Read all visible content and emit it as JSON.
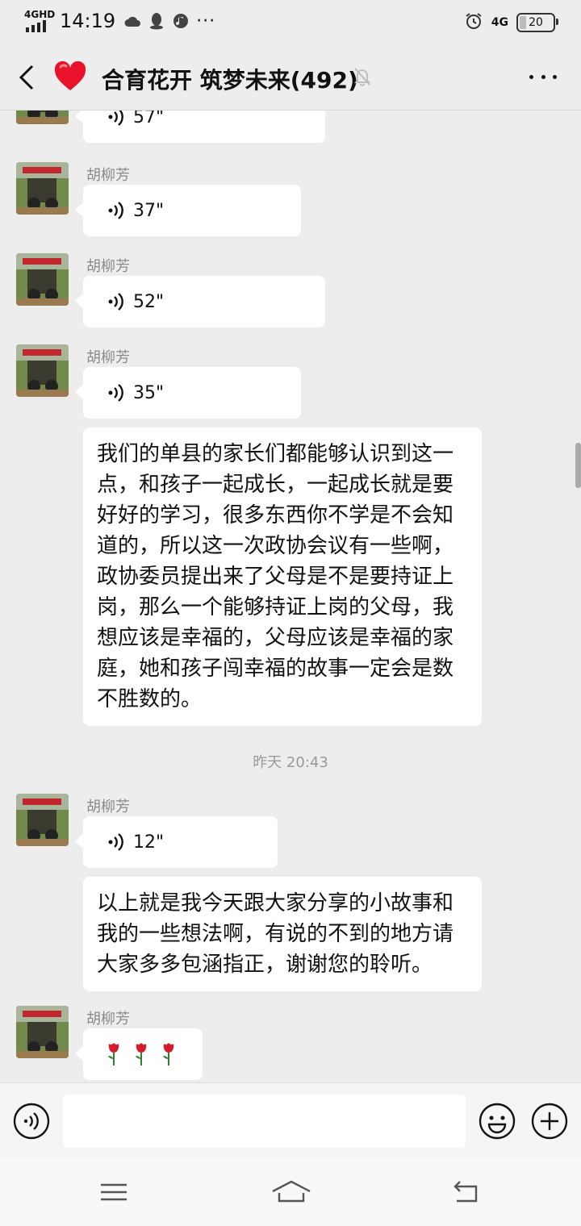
{
  "status_bar": {
    "network": "4GHD",
    "time": "14:19",
    "dots": "···",
    "network_right": "4G",
    "battery": "20"
  },
  "header": {
    "title": "合育花开 筑梦未来(492)",
    "avatar_icon": "heart-icon"
  },
  "messages": [
    {
      "type": "voice",
      "sender": "",
      "duration": "57\""
    },
    {
      "type": "voice",
      "sender": "胡柳芳",
      "duration": "37\""
    },
    {
      "type": "voice",
      "sender": "胡柳芳",
      "duration": "52\""
    },
    {
      "type": "voice",
      "sender": "胡柳芳",
      "duration": "35\""
    },
    {
      "type": "text",
      "text": "我们的单县的家长们都能够认识到这一点，和孩子一起成长，一起成长就是要好好的学习，很多东西你不学是不会知道的，所以这一次政协会议有一些啊，政协委员提出来了父母是不是要持证上岗，那么一个能够持证上岗的父母，我想应该是幸福的，父母应该是幸福的家庭，她和孩子闯幸福的故事一定会是数不胜数的。"
    },
    {
      "type": "time",
      "text": "昨天 20:43"
    },
    {
      "type": "voice",
      "sender": "胡柳芳",
      "duration": "12\""
    },
    {
      "type": "text",
      "text": "以上就是我今天跟大家分享的小故事和我的一些想法啊，有说的不到的地方请大家多多包涵指正，谢谢您的聆听。"
    },
    {
      "type": "emoji",
      "sender": "胡柳芳",
      "emoji": "🌹🌹🌹",
      "icon": "rose-icon"
    }
  ],
  "input_bar": {
    "placeholder": ""
  },
  "colors": {
    "background": "#ededed",
    "bubble": "#ffffff",
    "sender": "#8a8a8a"
  }
}
